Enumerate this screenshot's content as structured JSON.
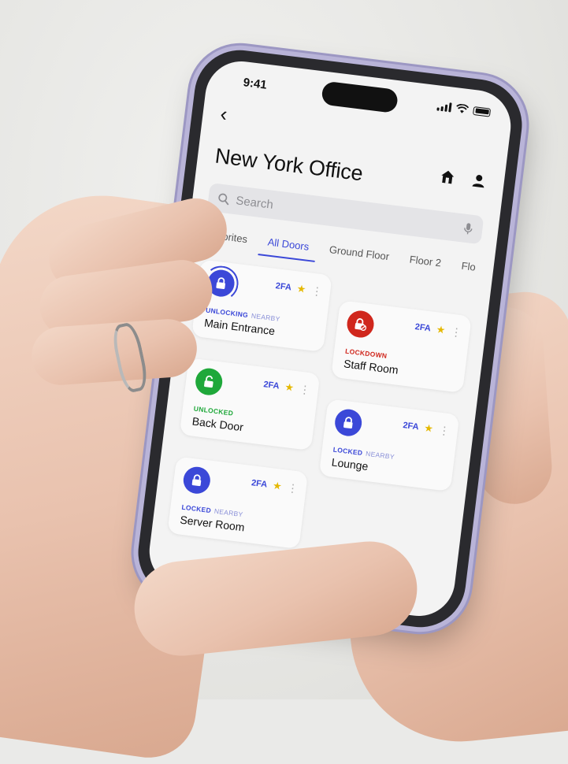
{
  "status_bar": {
    "time": "9:41"
  },
  "header": {
    "title": "New York Office",
    "back_icon": "chevron-left-icon",
    "home_icon": "home-icon",
    "profile_icon": "person-icon"
  },
  "search": {
    "placeholder": "Search"
  },
  "tabs": [
    {
      "label": "Favorites",
      "active": false
    },
    {
      "label": "All Doors",
      "active": true
    },
    {
      "label": "Ground Floor",
      "active": false
    },
    {
      "label": "Floor 2",
      "active": false
    },
    {
      "label": "Flo",
      "active": false
    }
  ],
  "doors": [
    {
      "name": "Main Entrance",
      "status": "UNLOCKING",
      "nearby": "NEARBY",
      "badge": "2FA",
      "star": "★",
      "more": "⋮",
      "color": "#3b48d8"
    },
    {
      "name": "Staff Room",
      "status": "LOCKDOWN",
      "nearby": "",
      "badge": "2FA",
      "star": "★",
      "more": "⋮",
      "color": "#d0271d"
    },
    {
      "name": "Back Door",
      "status": "UNLOCKED",
      "nearby": "",
      "badge": "2FA",
      "star": "★",
      "more": "⋮",
      "color": "#1fa83a"
    },
    {
      "name": "Lounge",
      "status": "LOCKED",
      "nearby": "NEARBY",
      "badge": "2FA",
      "star": "★",
      "more": "⋮",
      "color": "#3b48d8"
    },
    {
      "name": "Server Room",
      "status": "LOCKED",
      "nearby": "NEARBY",
      "badge": "2FA",
      "star": "★",
      "more": "⋮",
      "color": "#3b48d8"
    }
  ],
  "colors": {
    "accent": "#3b48d8",
    "lockdown": "#d0271d",
    "unlocked": "#1fa83a",
    "star": "#e5b800"
  }
}
